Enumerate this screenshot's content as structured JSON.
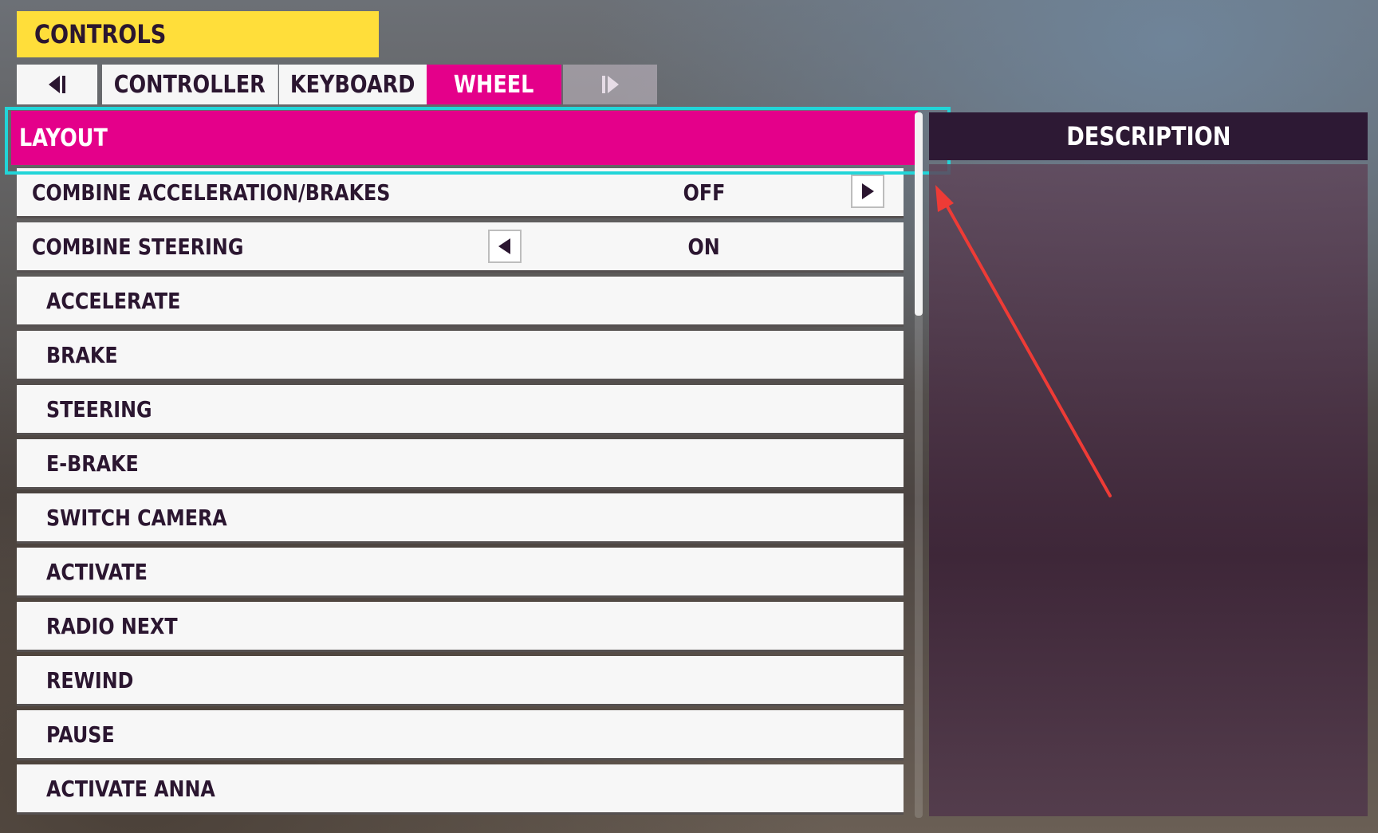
{
  "header": {
    "title": "CONTROLS"
  },
  "tabs": {
    "prev_icon": "prev-tab-icon",
    "items": [
      {
        "label": "CONTROLLER"
      },
      {
        "label": "KEYBOARD"
      },
      {
        "label": "WHEEL"
      }
    ],
    "next_icon": "next-tab-icon",
    "active": "WHEEL"
  },
  "section": {
    "label": "LAYOUT"
  },
  "rows": [
    {
      "label": "COMBINE ACCELERATION/BRAKES",
      "value": "OFF"
    },
    {
      "label": "COMBINE STEERING",
      "value": "ON"
    },
    {
      "label": "ACCELERATE"
    },
    {
      "label": "BRAKE"
    },
    {
      "label": "STEERING"
    },
    {
      "label": "E-BRAKE"
    },
    {
      "label": "SWITCH CAMERA"
    },
    {
      "label": "ACTIVATE"
    },
    {
      "label": "RADIO NEXT"
    },
    {
      "label": "REWIND"
    },
    {
      "label": "PAUSE"
    },
    {
      "label": "ACTIVATE ANNA"
    }
  ],
  "description": {
    "title": "DESCRIPTION"
  },
  "colors": {
    "header_yellow": "#ffde3a",
    "accent_magenta": "#e4008a",
    "text_dark": "#2b1630",
    "panel_dark": "#2d1934",
    "highlight_cyan": "#22d5d8",
    "annotation_red": "#ee3b36"
  }
}
